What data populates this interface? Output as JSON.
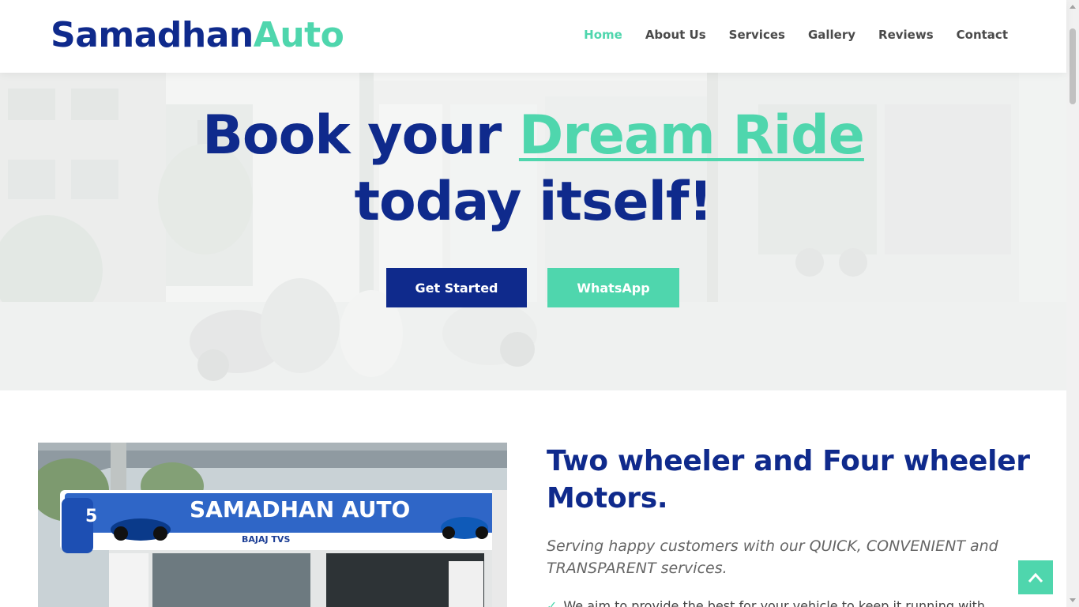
{
  "brand": {
    "part1": "Samadhan",
    "part2": "Auto"
  },
  "nav": [
    {
      "label": "Home",
      "active": true
    },
    {
      "label": "About Us"
    },
    {
      "label": "Services"
    },
    {
      "label": "Gallery"
    },
    {
      "label": "Reviews"
    },
    {
      "label": "Contact"
    }
  ],
  "hero": {
    "title_prefix": "Book your ",
    "title_highlight": "Dream Ride",
    "title_suffix": "today itself!",
    "cta_primary": "Get Started",
    "cta_secondary": "WhatsApp"
  },
  "about": {
    "shop_sign": "SAMADHAN AUTO",
    "shop_brands": "BAJAJ  TVS",
    "title": "Two wheeler and Four wheeler Motors.",
    "subtitle": "Serving happy customers with our QUICK, CONVENIENT and TRANSPARENT services.",
    "first_point": "We aim to provide the best for your vehicle to keep it running with"
  },
  "icons": {
    "check": "check-icon",
    "back_to_top": "chevron-up-icon"
  },
  "colors": {
    "primary": "#0f2a8c",
    "accent": "#4fd6ad",
    "nav_text": "#4a4a4a"
  }
}
